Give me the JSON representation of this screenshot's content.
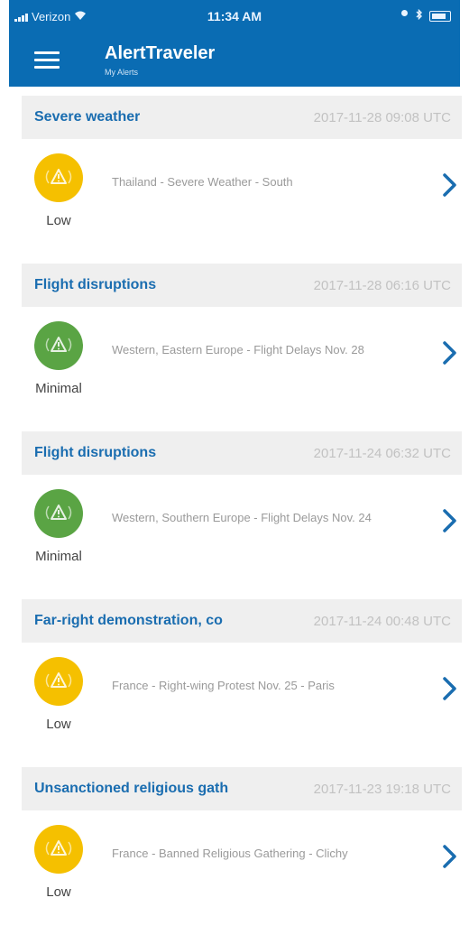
{
  "status_bar": {
    "carrier": "Verizon",
    "time": "11:34 AM"
  },
  "header": {
    "title": "AlertTraveler",
    "subtitle": "My Alerts"
  },
  "colors": {
    "brand": "#0a6cb3",
    "link": "#1a6db0",
    "low": "#f5c000",
    "minimal": "#5aa444"
  },
  "alerts": [
    {
      "title": "Severe weather",
      "date": "2017-11-28 09:08 UTC",
      "level": "Low",
      "description": "Thailand - Severe Weather - South",
      "icon": "alert-waves-icon"
    },
    {
      "title": "Flight disruptions",
      "date": "2017-11-28 06:16 UTC",
      "level": "Minimal",
      "description": "Western, Eastern Europe - Flight Delays Nov. 28",
      "icon": "alert-waves-icon"
    },
    {
      "title": "Flight disruptions",
      "date": "2017-11-24 06:32 UTC",
      "level": "Minimal",
      "description": "Western, Southern Europe - Flight Delays Nov. 24",
      "icon": "alert-waves-icon"
    },
    {
      "title": "Far-right demonstration, co",
      "date": "2017-11-24 00:48 UTC",
      "level": "Low",
      "description": "France - Right-wing Protest Nov. 25 - Paris",
      "icon": "alert-waves-icon"
    },
    {
      "title": "Unsanctioned religious gath",
      "date": "2017-11-23 19:18 UTC",
      "level": "Low",
      "description": "France - Banned Religious Gathering - Clichy",
      "icon": "alert-waves-icon"
    }
  ]
}
